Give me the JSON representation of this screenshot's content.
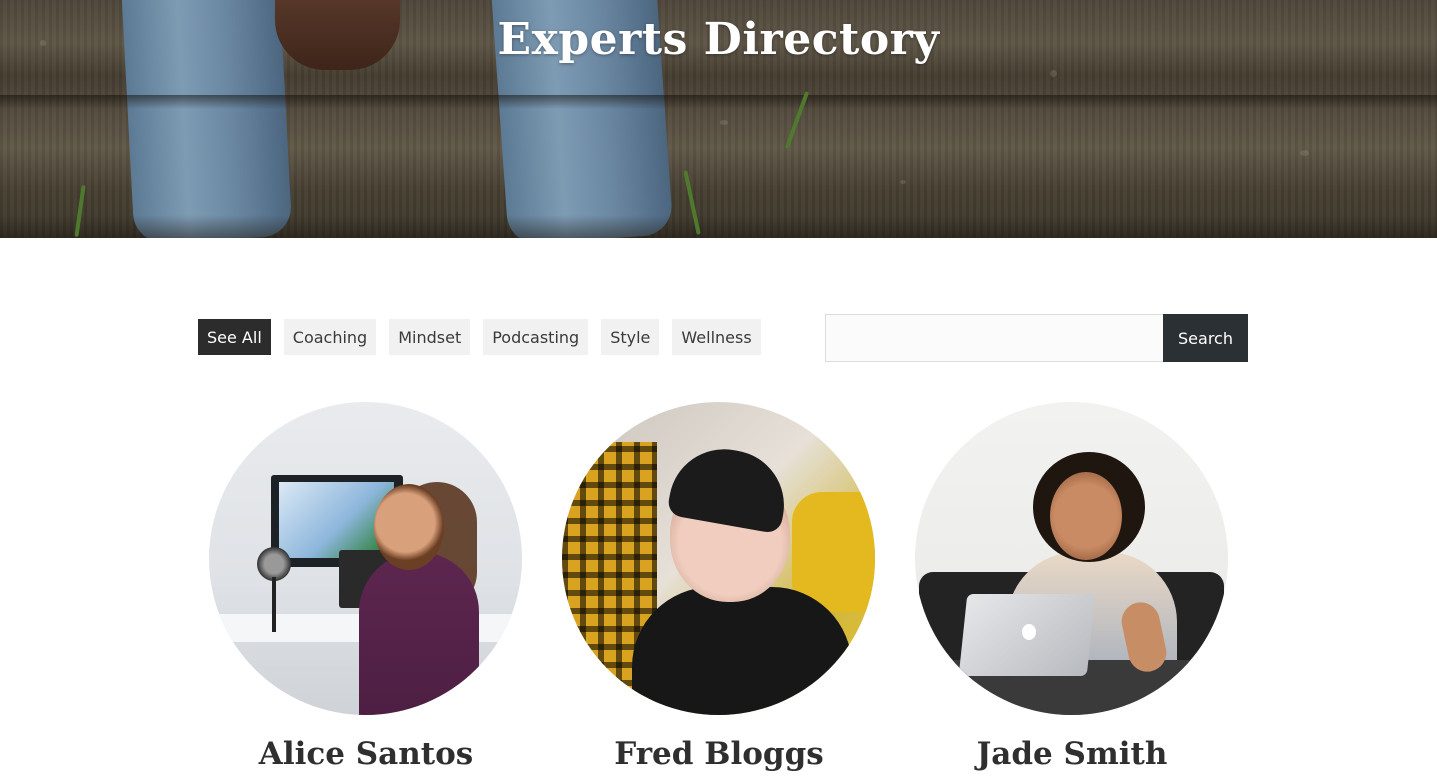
{
  "hero": {
    "title": "Experts Directory"
  },
  "filters": {
    "items": [
      {
        "label": "See All",
        "active": true
      },
      {
        "label": "Coaching",
        "active": false
      },
      {
        "label": "Mindset",
        "active": false
      },
      {
        "label": "Podcasting",
        "active": false
      },
      {
        "label": "Style",
        "active": false
      },
      {
        "label": "Wellness",
        "active": false
      }
    ]
  },
  "search": {
    "value": "",
    "placeholder": "",
    "button_label": "Search"
  },
  "experts": [
    {
      "name": "Alice Santos"
    },
    {
      "name": "Fred Bloggs"
    },
    {
      "name": "Jade Smith"
    }
  ],
  "colors": {
    "active_filter_bg": "#2c2c2c",
    "filter_bg": "#f1f1f1",
    "search_button_bg": "#2a3034"
  }
}
